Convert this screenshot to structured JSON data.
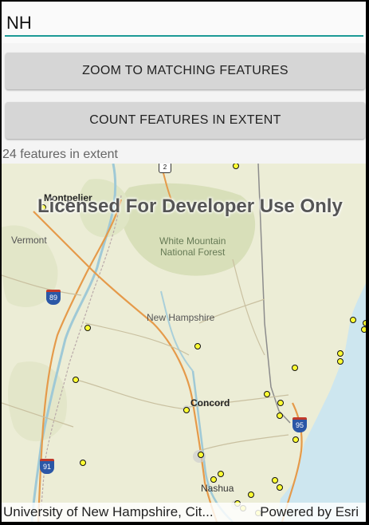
{
  "search": {
    "value": "NH"
  },
  "buttons": {
    "zoom_label": "ZOOM TO MATCHING FEATURES",
    "count_label": "COUNT FEATURES IN EXTENT"
  },
  "status": {
    "text": "24 features in extent"
  },
  "map": {
    "watermark": "Licensed For Developer Use Only",
    "labels": {
      "montpelier": "Montpelier",
      "vermont": "Vermont",
      "forest_line1": "White Mountain",
      "forest_line2": "National Forest",
      "new_hampshire": "New Hampshire",
      "concord": "Concord",
      "nashua": "Nashua"
    },
    "shields": {
      "i89": "89",
      "i91": "91",
      "i95": "95",
      "us2": "2"
    },
    "attribution": "University of New Hampshire, Cit...",
    "powered_by": "Powered by Esri",
    "colors": {
      "land": "#ecedd6",
      "forest": "#d9e0bc",
      "water": "#cde6ef",
      "feature_marker": "#ffff33"
    }
  }
}
